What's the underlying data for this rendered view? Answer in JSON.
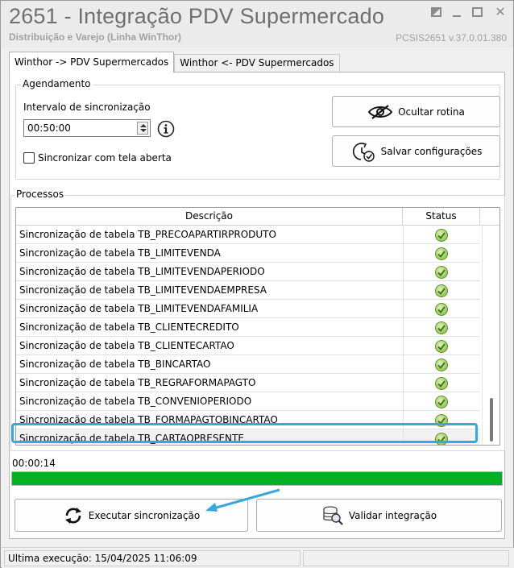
{
  "window": {
    "title": "2651 - Integração PDV Supermercado",
    "subtitle": "Distribuição e Varejo (Linha WinThor)",
    "version": "PCSIS2651  v.37.0.01.380"
  },
  "tabs": [
    {
      "label": "Winthor -> PDV Supermercados",
      "active": true
    },
    {
      "label": "Winthor <- PDV Supermercados",
      "active": false
    }
  ],
  "agendamento": {
    "group_label": "Agendamento",
    "interval_label": "Intervalo de sincronização",
    "interval_value": "00:50:00",
    "info_icon": "info-icon",
    "checkbox_label": "Sincronizar com tela aberta",
    "checkbox_checked": false
  },
  "actions": {
    "hide_routine": "Ocultar rotina",
    "save_settings": "Salvar configurações"
  },
  "processos": {
    "group_label": "Processos",
    "columns": [
      "Descrição",
      "Status"
    ],
    "rows": [
      {
        "desc": "Sincronização de tabela TB_PRECOAPARTIRPRODUTO",
        "status": "ok"
      },
      {
        "desc": "Sincronização de tabela TB_LIMITEVENDA",
        "status": "ok"
      },
      {
        "desc": "Sincronização de tabela TB_LIMITEVENDAPERIODO",
        "status": "ok"
      },
      {
        "desc": "Sincronização de tabela TB_LIMITEVENDAEMPRESA",
        "status": "ok"
      },
      {
        "desc": "Sincronização de tabela TB_LIMITEVENDAFAMILIA",
        "status": "ok"
      },
      {
        "desc": "Sincronização de tabela TB_CLIENTECREDITO",
        "status": "ok"
      },
      {
        "desc": "Sincronização de tabela TB_CLIENTECARTAO",
        "status": "ok"
      },
      {
        "desc": "Sincronização de tabela TB_BINCARTAO",
        "status": "ok"
      },
      {
        "desc": "Sincronização de tabela TB_REGRAFORMAPAGTO",
        "status": "ok"
      },
      {
        "desc": "Sincronização de tabela TB_CONVENIOPERIODO",
        "status": "ok"
      },
      {
        "desc": "Sincronização de tabela TB_FORMAPAGTOBINCARTAO",
        "status": "ok"
      },
      {
        "desc": "Sincronização de tabela TB_CARTAOPRESENTE",
        "status": "ok"
      }
    ],
    "selected_row": 11
  },
  "progress": {
    "elapsed": "00:00:14",
    "fraction": 1.0,
    "color": "#06b025"
  },
  "footer_buttons": {
    "execute": "Executar sincronização",
    "validate": "Validar integração"
  },
  "statusbar": {
    "last_run": "Ultima execução: 15/04/2025 11:06:09"
  },
  "colors": {
    "highlight": "#3aa7dc",
    "status_ok": "#8bc34a"
  }
}
